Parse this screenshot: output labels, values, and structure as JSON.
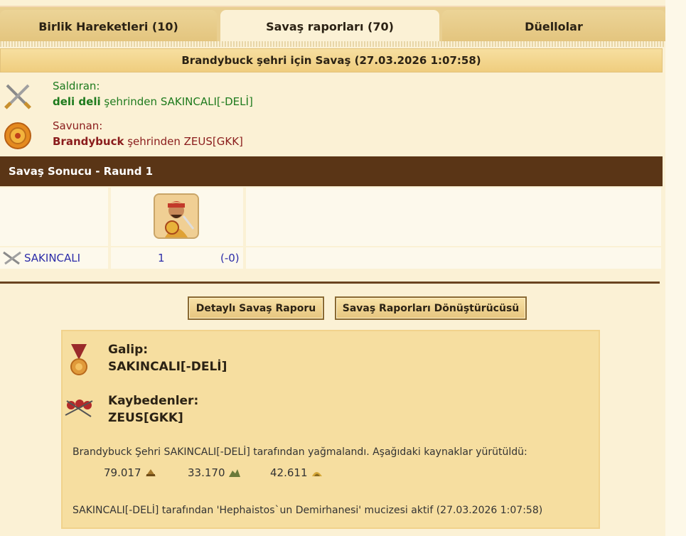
{
  "tabs": [
    {
      "label": "Birlik Hareketleri (10)"
    },
    {
      "label": "Savaş raporları (70)"
    },
    {
      "label": "Düellolar"
    }
  ],
  "report": {
    "title": "Brandybuck şehri için Savaş (27.03.2026 1:07:58)",
    "attacker": {
      "label": "Saldıran:",
      "city": "deli deli",
      "connector": " şehrinden ",
      "player": "SAKINCALI[-DELİ]"
    },
    "defender": {
      "label": "Savunan:",
      "city": "Brandybuck",
      "connector": " şehrinden ",
      "player": "ZEUS[GKK]"
    }
  },
  "round": {
    "title": "Savaş Sonucu - Raund 1",
    "row": {
      "name": "SAKINCALI",
      "count": "1",
      "loss": "(-0)"
    }
  },
  "buttons": {
    "detail": "Detaylı Savaş Raporu",
    "converter": "Savaş Raporları Dönüştürücüsü"
  },
  "result": {
    "winner_label": "Galip:",
    "winner": "SAKINCALI[-DELİ]",
    "losers_label": "Kaybedenler:",
    "losers": "ZEUS[GKK]",
    "loot_text": "Brandybuck Şehri SAKINCALI[-DELİ] tarafından yağmalandı. Aşağıdaki kaynaklar yürütüldü:",
    "resources": [
      {
        "value": "79.017",
        "icon": "wood-icon"
      },
      {
        "value": "33.170",
        "icon": "stone-icon"
      },
      {
        "value": "42.611",
        "icon": "silver-icon"
      }
    ],
    "miracle_text": "SAKINCALI[-DELİ] tarafından 'Hephaistos`un Demirhanesi' mucizesi aktif (27.03.2026 1:07:58)"
  },
  "colors": {
    "attacker": "#1d7a1d",
    "defender": "#8a1c1c",
    "round_bar": "#5a3516",
    "link": "#2c2ca8"
  }
}
